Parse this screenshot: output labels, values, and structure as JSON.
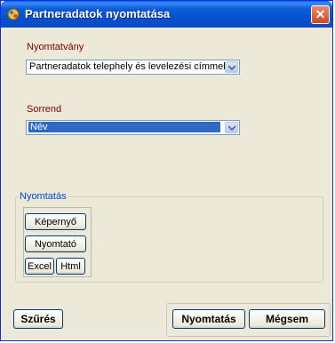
{
  "window": {
    "title": "Partneradatok nyomtatása",
    "close_glyph": "✕"
  },
  "form": {
    "nyomtatvany_label": "Nyomtatvány",
    "nyomtatvany_value": "Partneradatok telephely és levelezési címmel",
    "sorrend_label": "Sorrend",
    "sorrend_value": "Név"
  },
  "print_group": {
    "legend": "Nyomtatás",
    "kepernyo": "Képernyő",
    "nyomtato": "Nyomtató",
    "excel": "Excel",
    "html": "Html"
  },
  "footer": {
    "szures": "Szűrés",
    "nyomtatas": "Nyomtatás",
    "megsem": "Mégsem"
  },
  "colors": {
    "titlebar": "#0b5bd8",
    "label": "#800000",
    "group_legend": "#0046d5",
    "selection": "#316ac5"
  },
  "icons": {
    "app": "app-icon",
    "close": "close-icon",
    "dropdown": "chevron-down-icon"
  }
}
